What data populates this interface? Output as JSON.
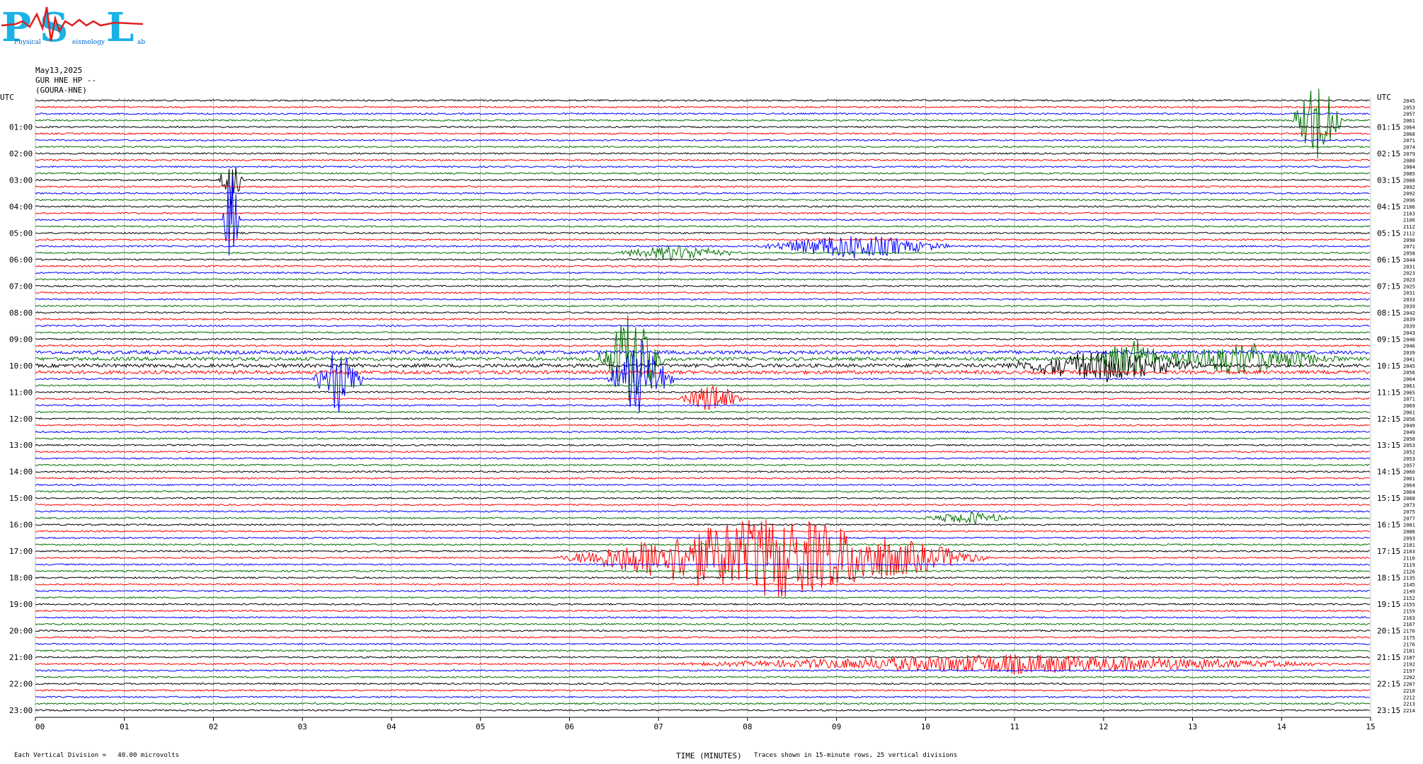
{
  "logo": {
    "letters": [
      "P",
      "S",
      "L"
    ],
    "sub_left": "Physical",
    "sub_mid": "eismology",
    "sub_right": "ab"
  },
  "header": {
    "date": "May13,2025",
    "station": "GUR HNE HP --",
    "location": "(GOURA-HNE)"
  },
  "footer": {
    "scale": "Each Vertical Division =   40.00 microvolts",
    "time_label": "TIME (MINUTES)",
    "note": "Traces shown in 15-minute rows, 25 vertical divisions"
  },
  "colors": {
    "black": "#000000",
    "red": "#ff0000",
    "blue": "#0000ff",
    "green": "#007000",
    "grid": "#888888"
  },
  "chart_data": {
    "type": "line",
    "title": "",
    "xlabel": "TIME (MINUTES)",
    "ylabel": "UTC",
    "xlim": [
      0,
      15
    ],
    "x_ticks": [
      "00",
      "01",
      "02",
      "03",
      "04",
      "05",
      "06",
      "07",
      "08",
      "09",
      "10",
      "11",
      "12",
      "13",
      "14",
      "15"
    ],
    "rows_per_hour": 4,
    "row_colors": [
      "black",
      "red",
      "blue",
      "green"
    ],
    "left_axis_title": "UTC",
    "right_axis_title": "UTC",
    "left_labels": [
      "01:00",
      "02:00",
      "03:00",
      "04:00",
      "05:00",
      "06:00",
      "07:00",
      "08:00",
      "09:00",
      "10:00",
      "11:00",
      "12:00",
      "13:00",
      "14:00",
      "15:00",
      "16:00",
      "17:00",
      "18:00",
      "19:00",
      "20:00",
      "21:00",
      "22:00",
      "23:00"
    ],
    "right_labels": [
      "01:15",
      "02:15",
      "03:15",
      "04:15",
      "05:15",
      "06:15",
      "07:15",
      "08:15",
      "09:15",
      "10:15",
      "11:15",
      "12:15",
      "13:15",
      "14:15",
      "15:15",
      "16:15",
      "17:15",
      "18:15",
      "19:15",
      "20:15",
      "21:15",
      "22:15",
      "23:15"
    ],
    "row_values": [
      "2045",
      "2053",
      "2057",
      "2061",
      "2064",
      "2068",
      "2071",
      "2074",
      "2079",
      "2080",
      "2084",
      "2085",
      "2088",
      "2092",
      "2092",
      "2096",
      "2106",
      "2103",
      "2106",
      "2112",
      "2112",
      "2090",
      "2071",
      "2058",
      "2044",
      "2031",
      "2023",
      "2023",
      "2025",
      "2031",
      "2033",
      "2039",
      "2042",
      "2039",
      "2039",
      "2043",
      "2040",
      "2046",
      "2039",
      "2041",
      "2045",
      "2056",
      "2064",
      "2061",
      "2065",
      "2071",
      "2069",
      "2061",
      "2056",
      "2049",
      "2049",
      "2050",
      "2053",
      "2052",
      "2053",
      "2057",
      "2060",
      "2061",
      "2064",
      "2064",
      "2068",
      "2073",
      "2075",
      "2077",
      "2081",
      "2086",
      "2093",
      "2101",
      "2103",
      "2110",
      "2119",
      "2126",
      "2135",
      "2145",
      "2149",
      "2152",
      "2155",
      "2159",
      "2163",
      "2167",
      "2170",
      "2175",
      "2176",
      "2181",
      "2187",
      "2192",
      "2197",
      "2202",
      "2207",
      "2210",
      "2212",
      "2213",
      "2214"
    ],
    "events": [
      {
        "minute": 2.2,
        "row": 18,
        "amplitude": 9.0,
        "color": "green",
        "width": 0.1
      },
      {
        "minute": 2.2,
        "row": 12,
        "amplitude": 4.0,
        "color": "green",
        "width": 0.15
      },
      {
        "minute": 14.4,
        "row": 3,
        "amplitude": 7.0,
        "color": "red",
        "width": 0.3
      },
      {
        "minute": 6.7,
        "row": 39,
        "amplitude": 7.5,
        "color": "red",
        "width": 0.4
      },
      {
        "minute": 6.8,
        "row": 42,
        "amplitude": 6.0,
        "color": "blue",
        "width": 0.4
      },
      {
        "minute": 3.4,
        "row": 42,
        "amplitude": 5.5,
        "color": "blue",
        "width": 0.3
      },
      {
        "minute": 12.3,
        "row": 39,
        "amplitude": 3.5,
        "color": "red",
        "width": 0.4
      },
      {
        "minute": 9.2,
        "row": 22,
        "amplitude": 2.0,
        "color": "black",
        "width": 1.2
      },
      {
        "minute": 7.2,
        "row": 23,
        "amplitude": 1.2,
        "color": "red",
        "width": 0.8
      },
      {
        "minute": 8.3,
        "row": 69,
        "amplitude": 6.5,
        "color": "green",
        "width": 2.5
      },
      {
        "minute": 11.0,
        "row": 85,
        "amplitude": 1.5,
        "color": "green",
        "width": 4.0
      },
      {
        "minute": 10.5,
        "row": 63,
        "amplitude": 1.0,
        "color": "red",
        "width": 0.6
      },
      {
        "minute": 12.0,
        "row": 40,
        "amplitude": 2.5,
        "color": "black",
        "width": 1.2
      },
      {
        "minute": 13.5,
        "row": 39,
        "amplitude": 2.5,
        "color": "black",
        "width": 1.2
      },
      {
        "minute": 7.6,
        "row": 45,
        "amplitude": 2.5,
        "color": "red",
        "width": 0.4
      }
    ]
  }
}
